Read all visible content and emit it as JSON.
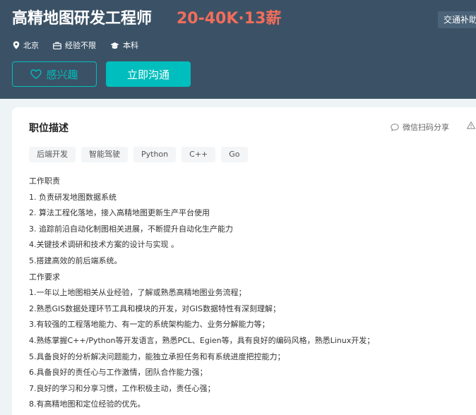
{
  "header": {
    "job_title": "高精地图研发工程师",
    "salary": "20-40K·13薪",
    "welfare_tag": "交通补助",
    "meta": {
      "location": "北京",
      "experience": "经验不限",
      "education": "本科"
    },
    "buttons": {
      "interest": "感兴趣",
      "chat": "立即沟通"
    }
  },
  "card": {
    "section_title": "职位描述",
    "share_label": "微信扫码分享",
    "tags": [
      "后端开发",
      "智能驾驶",
      "Python",
      "C++",
      "Go"
    ],
    "description": [
      "工作职责",
      "1. 负责研发地图数据系统",
      "2. 算法工程化落地，接入高精地图更新生产平台使用",
      "3. 追踪前沿自动化制图相关进展，不断提升自动化生产能力",
      "4.关键技术调研和技术方案的设计与实现 。",
      "5.搭建高效的前后端系统。",
      "工作要求",
      "1.一年以上地图相关从业经验，了解或熟悉高精地图业务流程；",
      "2.熟悉GIS数据处理环节工具和模块的开发，对GIS数据特性有深刻理解；",
      "3.有较强的工程落地能力、有一定的系统架构能力、业务分解能力等；",
      "4.熟练掌握C++/Python等开发语言，熟悉PCL、Egien等，具有良好的编码风格，熟悉Linux开发；",
      "5.具备良好的分析解决问题能力，能独立承担任务和有系统进度把控能力；",
      "6.具备良好的责任心与工作激情，团队合作能力强；",
      "7.良好的学习和分享习惯，工作积极主动，责任心强；",
      "8.有高精地图和定位经验的优先。"
    ]
  },
  "colors": {
    "header_bg": "#3b5266",
    "accent": "#00bebd",
    "salary": "#f26d5b"
  }
}
